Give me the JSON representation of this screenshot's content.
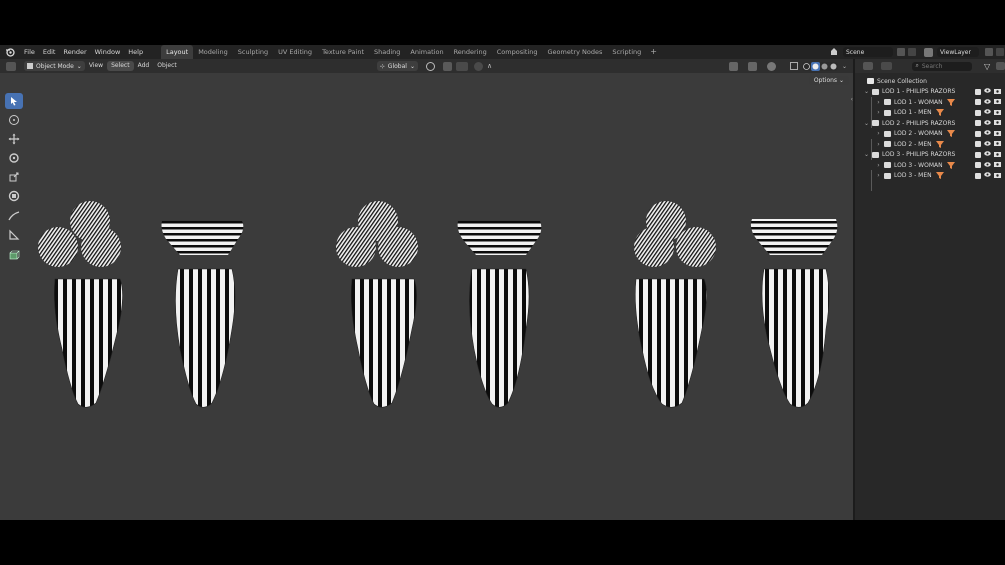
{
  "menubar": {
    "items": [
      "File",
      "Edit",
      "Render",
      "Window",
      "Help"
    ],
    "workspace_tabs": [
      "Layout",
      "Modeling",
      "Sculpting",
      "UV Editing",
      "Texture Paint",
      "Shading",
      "Animation",
      "Rendering",
      "Compositing",
      "Geometry Nodes",
      "Scripting"
    ],
    "active_tab": "Layout",
    "scene": "Scene",
    "view_layer": "ViewLayer"
  },
  "viewport": {
    "mode": "Object Mode",
    "menus": [
      "View",
      "Select",
      "Add",
      "Object"
    ],
    "active_menu": "Select",
    "transform_orientation": "Global",
    "options_label": "Options",
    "tools": [
      "select-box-icon",
      "cursor-icon",
      "move-icon",
      "rotate-icon",
      "scale-icon",
      "transform-icon",
      "annotate-icon",
      "measure-icon",
      "add-cube-icon"
    ]
  },
  "outliner": {
    "search_placeholder": "Search",
    "root": "Scene Collection",
    "rows": [
      {
        "label": "LOD 1 - PHILIPS RAZORS",
        "level": 1,
        "badge": false
      },
      {
        "label": "LOD 1 - WOMAN",
        "level": 2,
        "badge": true
      },
      {
        "label": "LOD 1 - MEN",
        "level": 2,
        "badge": true
      },
      {
        "label": "LOD 2 - PHILIPS RAZORS",
        "level": 1,
        "badge": false
      },
      {
        "label": "LOD 2 - WOMAN",
        "level": 2,
        "badge": true
      },
      {
        "label": "LOD 2 - MEN",
        "level": 2,
        "badge": true
      },
      {
        "label": "LOD 3 - PHILIPS RAZORS",
        "level": 1,
        "badge": false
      },
      {
        "label": "LOD 3 - WOMAN",
        "level": 2,
        "badge": true
      },
      {
        "label": "LOD 3 - MEN",
        "level": 2,
        "badge": true
      }
    ]
  },
  "colors": {
    "accent": "#4772b3",
    "badge": "#e8894a",
    "viewport_bg": "#3b3b3b"
  }
}
